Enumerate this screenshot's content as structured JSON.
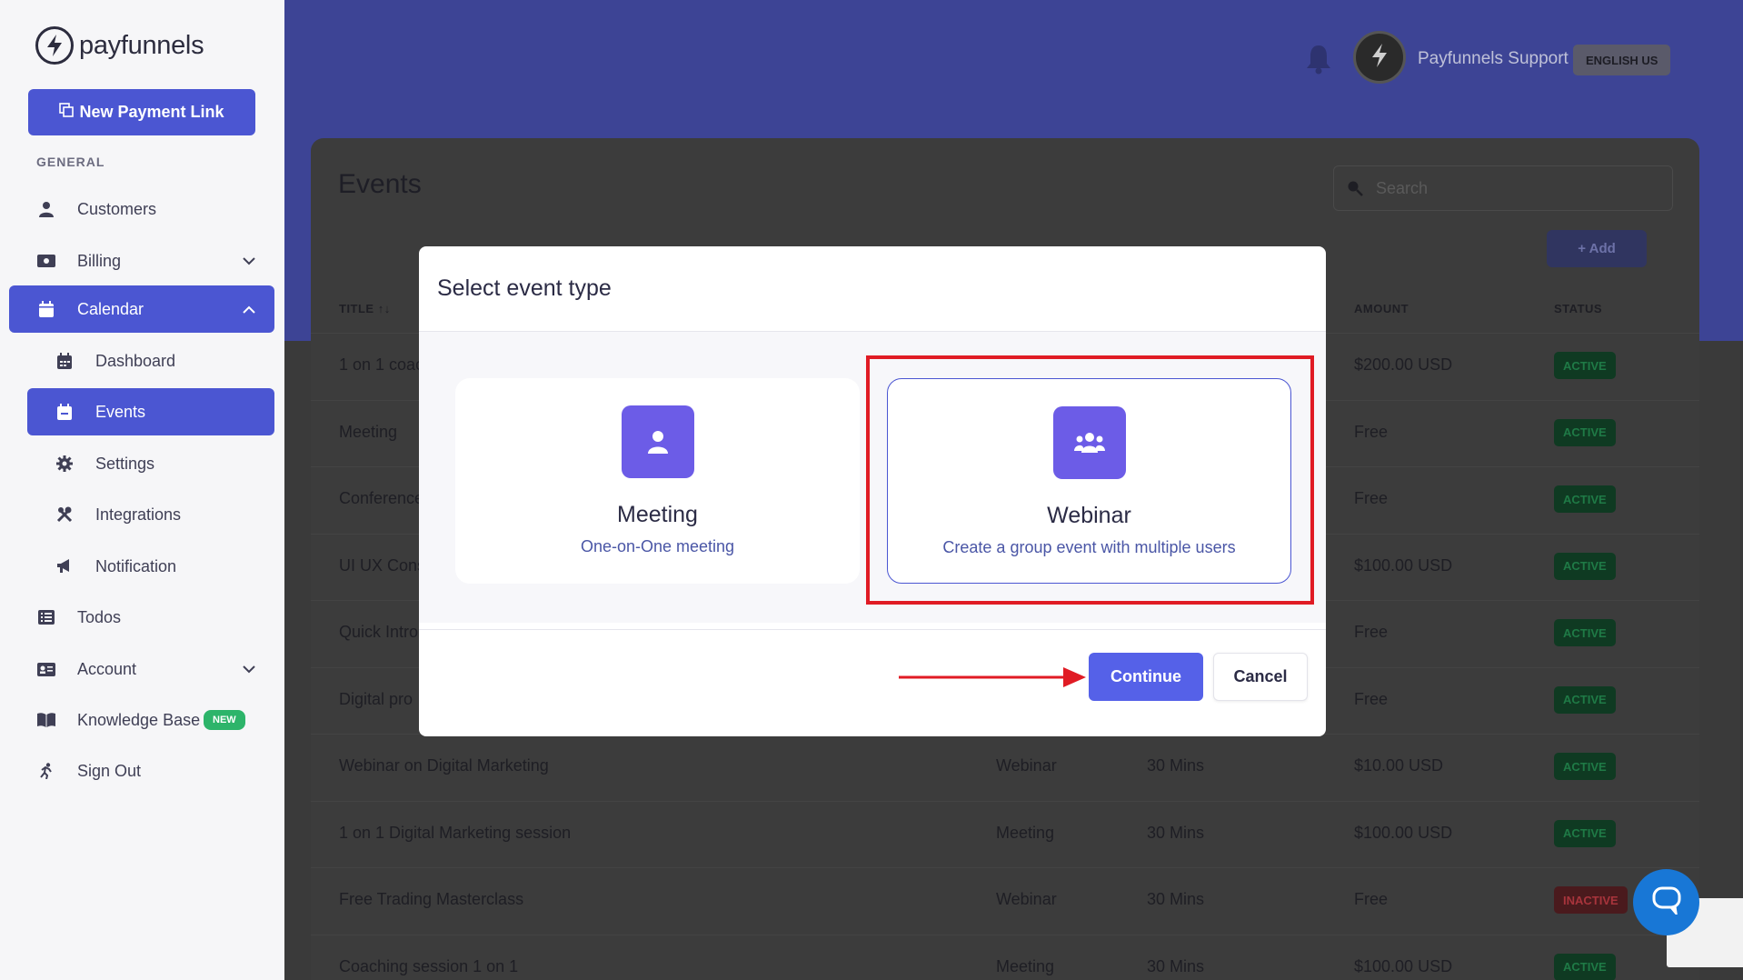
{
  "brand": {
    "name": "payfunnels"
  },
  "sidebar": {
    "new_link_label": "New Payment Link",
    "section_general": "GENERAL",
    "items": [
      {
        "label": "Customers",
        "icon": "user-icon"
      },
      {
        "label": "Billing",
        "icon": "money-icon"
      },
      {
        "label": "Calendar",
        "icon": "calendar-icon"
      },
      {
        "label": "Dashboard",
        "icon": "calendar-grid-icon"
      },
      {
        "label": "Events",
        "icon": "calendar-icon"
      },
      {
        "label": "Settings",
        "icon": "gear-icon"
      },
      {
        "label": "Integrations",
        "icon": "tools-icon"
      },
      {
        "label": "Notification",
        "icon": "megaphone-icon"
      },
      {
        "label": "Todos",
        "icon": "list-icon"
      },
      {
        "label": "Account",
        "icon": "id-card-icon"
      },
      {
        "label": "Knowledge Base",
        "icon": "book-icon"
      },
      {
        "label": "Sign Out",
        "icon": "run-icon"
      }
    ],
    "kb_badge": "NEW"
  },
  "header": {
    "user_name": "Payfunnels Support",
    "language": "ENGLISH US"
  },
  "events_page": {
    "title": "Events",
    "search_placeholder": "Search",
    "add_label": "+ Add",
    "columns": {
      "title": "TITLE",
      "amount": "AMOUNT",
      "status": "STATUS"
    },
    "rows": [
      {
        "title": "1 on 1 coac",
        "type": "",
        "duration": "",
        "amount": "$200.00 USD",
        "status": "ACTIVE"
      },
      {
        "title": "Meeting",
        "type": "",
        "duration": "",
        "amount": "Free",
        "status": "ACTIVE"
      },
      {
        "title": "Conference",
        "type": "",
        "duration": "",
        "amount": "Free",
        "status": "ACTIVE"
      },
      {
        "title": "UI UX Cons",
        "type": "",
        "duration": "",
        "amount": "$100.00 USD",
        "status": "ACTIVE"
      },
      {
        "title": "Quick Intro",
        "type": "",
        "duration": "",
        "amount": "Free",
        "status": "ACTIVE"
      },
      {
        "title": "Digital pro",
        "type": "",
        "duration": "",
        "amount": "Free",
        "status": "ACTIVE"
      },
      {
        "title": "Webinar on Digital Marketing",
        "type": "Webinar",
        "duration": "30 Mins",
        "amount": "$10.00 USD",
        "status": "ACTIVE"
      },
      {
        "title": "1 on 1 Digital Marketing session",
        "type": "Meeting",
        "duration": "30 Mins",
        "amount": "$100.00 USD",
        "status": "ACTIVE"
      },
      {
        "title": "Free Trading Masterclass",
        "type": "Webinar",
        "duration": "30 Mins",
        "amount": "Free",
        "status": "INACTIVE"
      },
      {
        "title": "Coaching session 1 on 1",
        "type": "Meeting",
        "duration": "30 Mins",
        "amount": "$100.00 USD",
        "status": "ACTIVE"
      }
    ]
  },
  "modal": {
    "title": "Select event type",
    "options": [
      {
        "name": "Meeting",
        "description": "One-on-One meeting",
        "icon": "user-icon"
      },
      {
        "name": "Webinar",
        "description": "Create a group event with multiple users",
        "icon": "users-group-icon"
      }
    ],
    "continue_label": "Continue",
    "cancel_label": "Cancel"
  },
  "colors": {
    "primary": "#4b56d2",
    "header_bg": "#3d4495",
    "icon_tile": "#6c5ce7",
    "annotation_red": "#e01b24",
    "active_green": "#2db46a"
  }
}
